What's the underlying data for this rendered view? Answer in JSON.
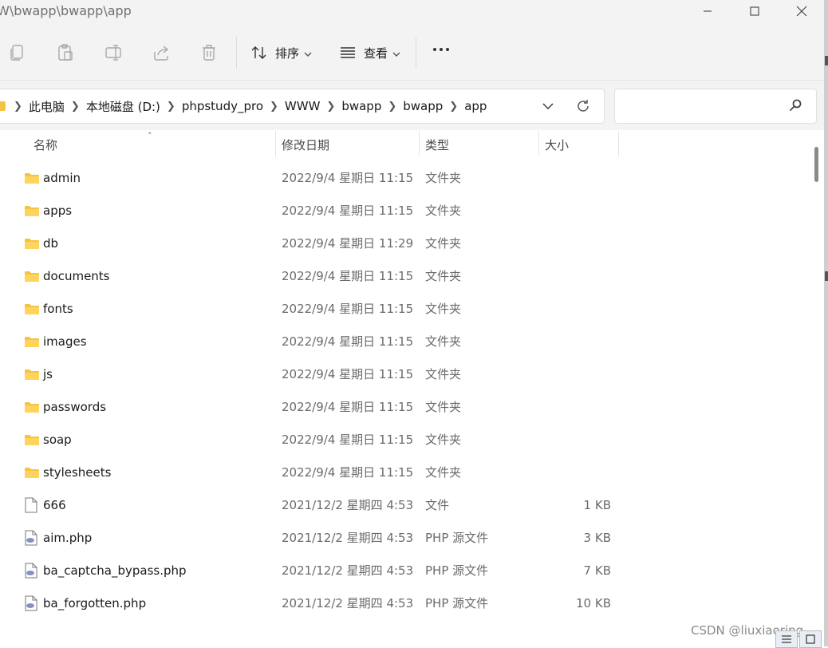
{
  "window": {
    "title": "W\\bwapp\\bwapp\\app"
  },
  "toolbar": {
    "sort_label": "排序",
    "view_label": "查看"
  },
  "address": {
    "crumbs": [
      "此电脑",
      "本地磁盘 (D:)",
      "phpstudy_pro",
      "WWW",
      "bwapp",
      "bwapp",
      "app"
    ]
  },
  "search": {
    "placeholder": "",
    "value": ""
  },
  "columns": {
    "name": "名称",
    "date": "修改日期",
    "type": "类型",
    "size": "大小"
  },
  "files": [
    {
      "name": "admin",
      "date": "2022/9/4 星期日 11:15",
      "type": "文件夹",
      "size": "",
      "kind": "folder"
    },
    {
      "name": "apps",
      "date": "2022/9/4 星期日 11:15",
      "type": "文件夹",
      "size": "",
      "kind": "folder"
    },
    {
      "name": "db",
      "date": "2022/9/4 星期日 11:29",
      "type": "文件夹",
      "size": "",
      "kind": "folder"
    },
    {
      "name": "documents",
      "date": "2022/9/4 星期日 11:15",
      "type": "文件夹",
      "size": "",
      "kind": "folder"
    },
    {
      "name": "fonts",
      "date": "2022/9/4 星期日 11:15",
      "type": "文件夹",
      "size": "",
      "kind": "folder"
    },
    {
      "name": "images",
      "date": "2022/9/4 星期日 11:15",
      "type": "文件夹",
      "size": "",
      "kind": "folder"
    },
    {
      "name": "js",
      "date": "2022/9/4 星期日 11:15",
      "type": "文件夹",
      "size": "",
      "kind": "folder"
    },
    {
      "name": "passwords",
      "date": "2022/9/4 星期日 11:15",
      "type": "文件夹",
      "size": "",
      "kind": "folder"
    },
    {
      "name": "soap",
      "date": "2022/9/4 星期日 11:15",
      "type": "文件夹",
      "size": "",
      "kind": "folder"
    },
    {
      "name": "stylesheets",
      "date": "2022/9/4 星期日 11:15",
      "type": "文件夹",
      "size": "",
      "kind": "folder"
    },
    {
      "name": "666",
      "date": "2021/12/2 星期四 4:53",
      "type": "文件",
      "size": "1 KB",
      "kind": "file"
    },
    {
      "name": "aim.php",
      "date": "2021/12/2 星期四 4:53",
      "type": "PHP 源文件",
      "size": "3 KB",
      "kind": "php"
    },
    {
      "name": "ba_captcha_bypass.php",
      "date": "2021/12/2 星期四 4:53",
      "type": "PHP 源文件",
      "size": "7 KB",
      "kind": "php"
    },
    {
      "name": "ba_forgotten.php",
      "date": "2021/12/2 星期四 4:53",
      "type": "PHP 源文件",
      "size": "10 KB",
      "kind": "php"
    }
  ],
  "watermark": "CSDN @liuxiaoring",
  "colors": {
    "folder": "#f5c342",
    "chrome_bg": "#f3f3f3",
    "secondary_text": "#6b6b6b"
  }
}
